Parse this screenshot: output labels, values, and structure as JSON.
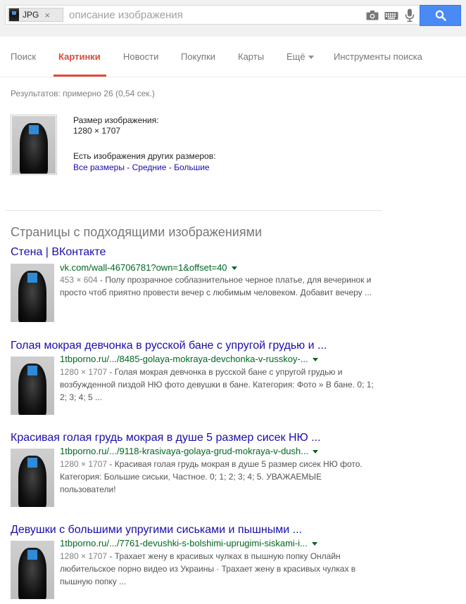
{
  "search": {
    "chip_label": "JPG",
    "chip_close": "×",
    "query": "описание изображения"
  },
  "nav": {
    "tabs": [
      {
        "label": "Поиск"
      },
      {
        "label": "Картинки"
      },
      {
        "label": "Новости"
      },
      {
        "label": "Покупки"
      },
      {
        "label": "Карты"
      },
      {
        "label": "Ещё"
      },
      {
        "label": "Инструменты поиска"
      }
    ]
  },
  "stats": "Результатов: примерно 26 (0,54 сек.)",
  "image_info": {
    "size_label": "Размер изображения:",
    "size_value": "1280 × 1707",
    "other_sizes": "Есть изображения других размеров:",
    "links": [
      "Все размеры",
      "Средние",
      "Большие"
    ],
    "separator": " - "
  },
  "section_heading": "Страницы с подходящими изображениями",
  "results": [
    {
      "title": "Стена | ВКонтакте",
      "url": "vk.com/wall-46706781?own=1&offset=40",
      "dims": "453 × 604",
      "snippet": " - Полу прозрачное соблазнительное черное платье, для вечеринок и просто чтоб приятно провести вечер с любимым человеком. Добавит вечеру ..."
    },
    {
      "title": "Голая мокрая девчонка в русской бане с упругой грудью и ...",
      "url": "1tbporno.ru/.../8485-golaya-mokraya-devchonka-v-russkoy-...",
      "dims": "1280 × 1707",
      "snippet": " - Голая мокрая девчонка в русской бане с упругой грудью и возбужденной пиздой НЮ фото девушки в бане. Категория: Фото » В бане. 0; 1; 2; 3; 4; 5 ..."
    },
    {
      "title": "Красивая голая грудь мокрая в душе 5 размер сисек НЮ ...",
      "url": "1tbporno.ru/.../9118-krasivaya-golaya-grud-mokraya-v-dush...",
      "dims": "1280 × 1707",
      "snippet": " - Красивая голая грудь мокрая в душе 5 размер сисек НЮ фото. Категория: Большие сиськи, Частное. 0; 1; 2; 3; 4; 5. УВАЖАЕМЫЕ пользователи!"
    },
    {
      "title": "Девушки с большими упругими сиськами и пышными ...",
      "url": "1tbporno.ru/.../7761-devushki-s-bolshimi-uprugimi-siskami-i...",
      "dims": "1280 × 1707",
      "snippet": " - Трахает жену в красивых чулках в пышную попку Онлайн любительское порно видео из Украины · Трахает жену в красивых чулках в пышную попку ..."
    }
  ],
  "colors": {
    "accent_red": "#dd4b39",
    "link_blue": "#1a0dab",
    "url_green": "#006621",
    "search_button": "#4a8af4"
  },
  "icons": [
    "camera-icon",
    "keyboard-icon",
    "microphone-icon",
    "search-icon"
  ]
}
